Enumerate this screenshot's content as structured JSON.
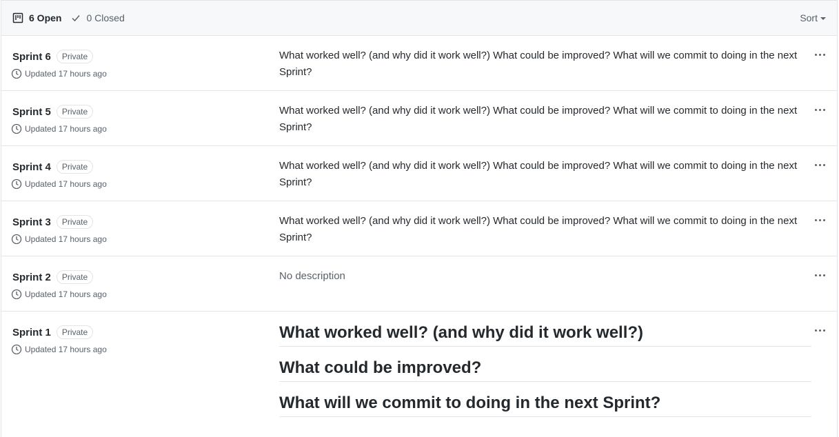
{
  "header": {
    "open_label": "6 Open",
    "closed_label": "0 Closed",
    "sort_label": "Sort"
  },
  "projects": [
    {
      "name": "Sprint 6",
      "badge": "Private",
      "updated": "Updated 17 hours ago",
      "description": "What worked well? (and why did it work well?) What could be improved? What will we commit to doing in the next Sprint?"
    },
    {
      "name": "Sprint 5",
      "badge": "Private",
      "updated": "Updated 17 hours ago",
      "description": "What worked well? (and why did it work well?) What could be improved? What will we commit to doing in the next Sprint?"
    },
    {
      "name": "Sprint 4",
      "badge": "Private",
      "updated": "Updated 17 hours ago",
      "description": "What worked well? (and why did it work well?) What could be improved? What will we commit to doing in the next Sprint?"
    },
    {
      "name": "Sprint 3",
      "badge": "Private",
      "updated": "Updated 17 hours ago",
      "description": "What worked well? (and why did it work well?) What could be improved? What will we commit to doing in the next Sprint?"
    },
    {
      "name": "Sprint 2",
      "badge": "Private",
      "updated": "Updated 17 hours ago",
      "description": "No description"
    },
    {
      "name": "Sprint 1",
      "badge": "Private",
      "updated": "Updated 17 hours ago",
      "headings": [
        "What worked well? (and why did it work well?)",
        "What could be improved?",
        "What will we commit to doing in the next Sprint?"
      ]
    }
  ],
  "icons": {
    "project": "project-board-icon",
    "check": "check-icon",
    "clock": "clock-icon",
    "more": "kebab-horizontal-icon"
  }
}
